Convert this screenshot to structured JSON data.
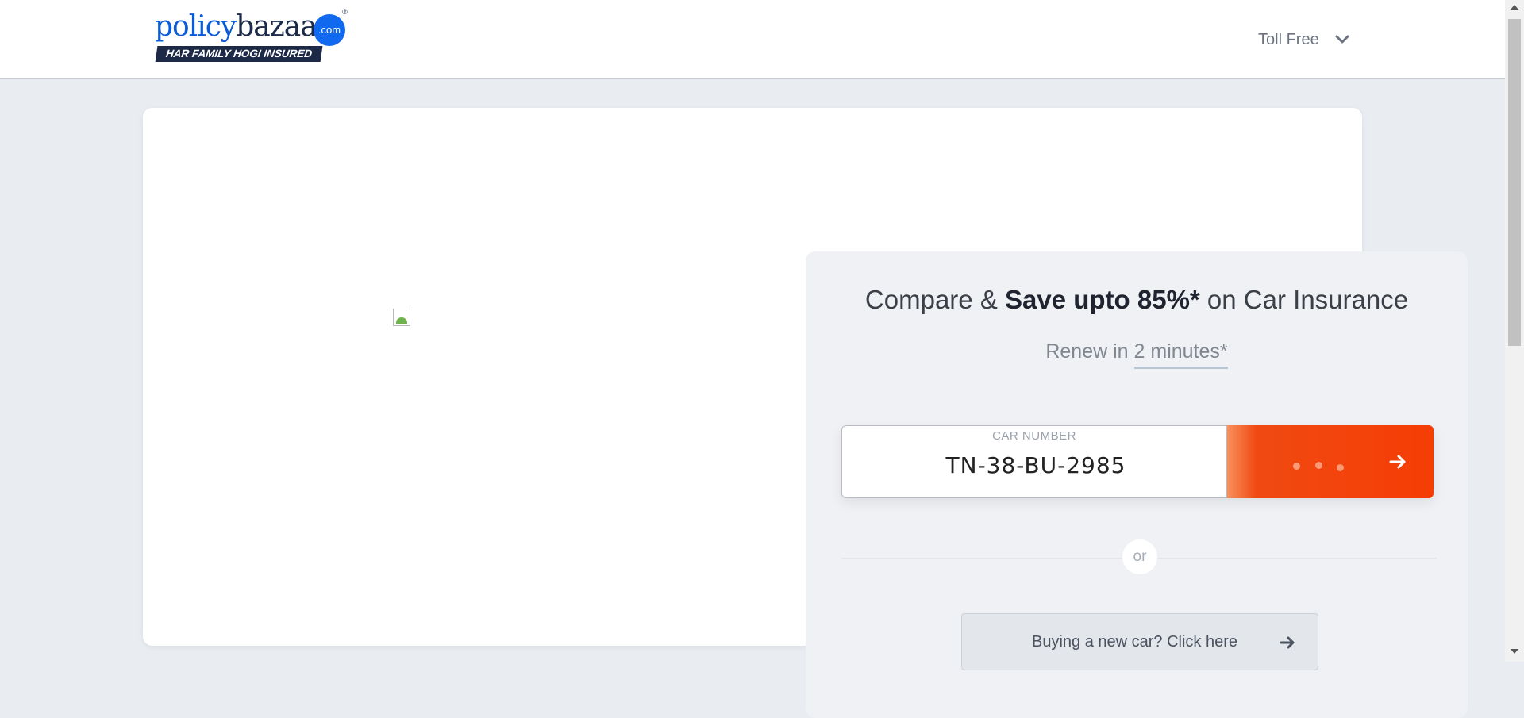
{
  "header": {
    "logo": {
      "brand_part1": "policy",
      "brand_part2": "bazaar",
      "domain_badge": ".com",
      "registered_mark": "®",
      "tagline": "HAR FAMILY HOGI INSURED"
    },
    "toll_free_label": "Toll Free",
    "toll_free_icon": "chevron-down-icon"
  },
  "main": {
    "image_placeholder": "broken-image-icon",
    "headline": {
      "part1": "Compare & ",
      "bold": "Save upto 85%*",
      "part2": " on Car Insurance"
    },
    "subline": {
      "prefix": "Renew in ",
      "underlined": "2 minutes*"
    },
    "car_number": {
      "label": "CAR NUMBER",
      "value": "TN-38-BU-2985"
    },
    "submit_icon": "arrow-right-icon",
    "or_text": "or",
    "new_car_button": {
      "label": "Buying a new car? Click here",
      "icon": "arrow-right-icon"
    }
  },
  "colors": {
    "brand_blue": "#0a5bd8",
    "navy": "#1c2a48",
    "cta_orange": "#f53d05",
    "page_bg": "#e9edf1"
  }
}
